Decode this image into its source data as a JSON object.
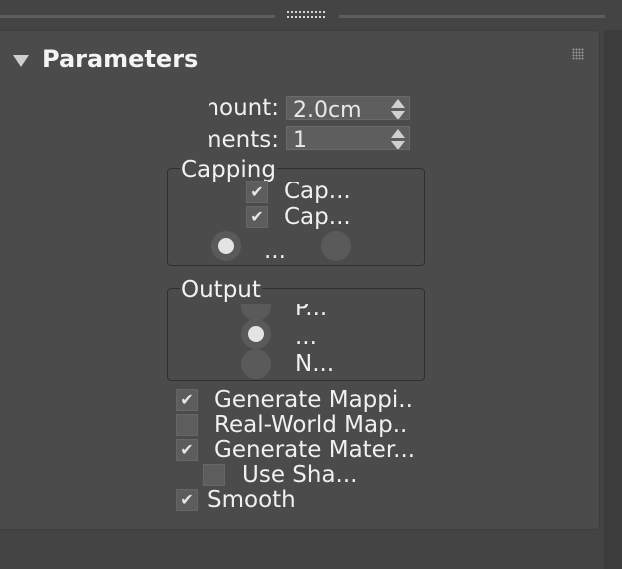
{
  "rollout": {
    "title": "Parameters"
  },
  "spinners": [
    {
      "label": "Amount:",
      "value": "2.0cm"
    },
    {
      "label": "Segments:",
      "value": "1"
    }
  ],
  "capping": {
    "title": "Capping",
    "checkboxes": [
      {
        "label": "Cap...",
        "checked": true
      },
      {
        "label": "Cap...",
        "checked": true
      }
    ],
    "radios": [
      {
        "label": "...",
        "selected": true
      },
      {
        "label": "",
        "selected": false
      }
    ]
  },
  "output": {
    "title": "Output",
    "radios": [
      {
        "label": "P...",
        "selected": false
      },
      {
        "label": "...",
        "selected": true
      },
      {
        "label": "N...",
        "selected": false
      }
    ]
  },
  "options": [
    {
      "label": "Generate Mappi..",
      "checked": true
    },
    {
      "label": "Real-World Map..",
      "checked": false
    },
    {
      "label": "Generate Mater...",
      "checked": true
    },
    {
      "label": "Use Sha...",
      "checked": false
    },
    {
      "label": "Smooth",
      "checked": true
    }
  ],
  "check_glyph": "✔",
  "colors": {
    "background": "#444444",
    "panel": "#4b4b4b",
    "control": "#5d5d5d",
    "text": "#f0f0f0"
  }
}
